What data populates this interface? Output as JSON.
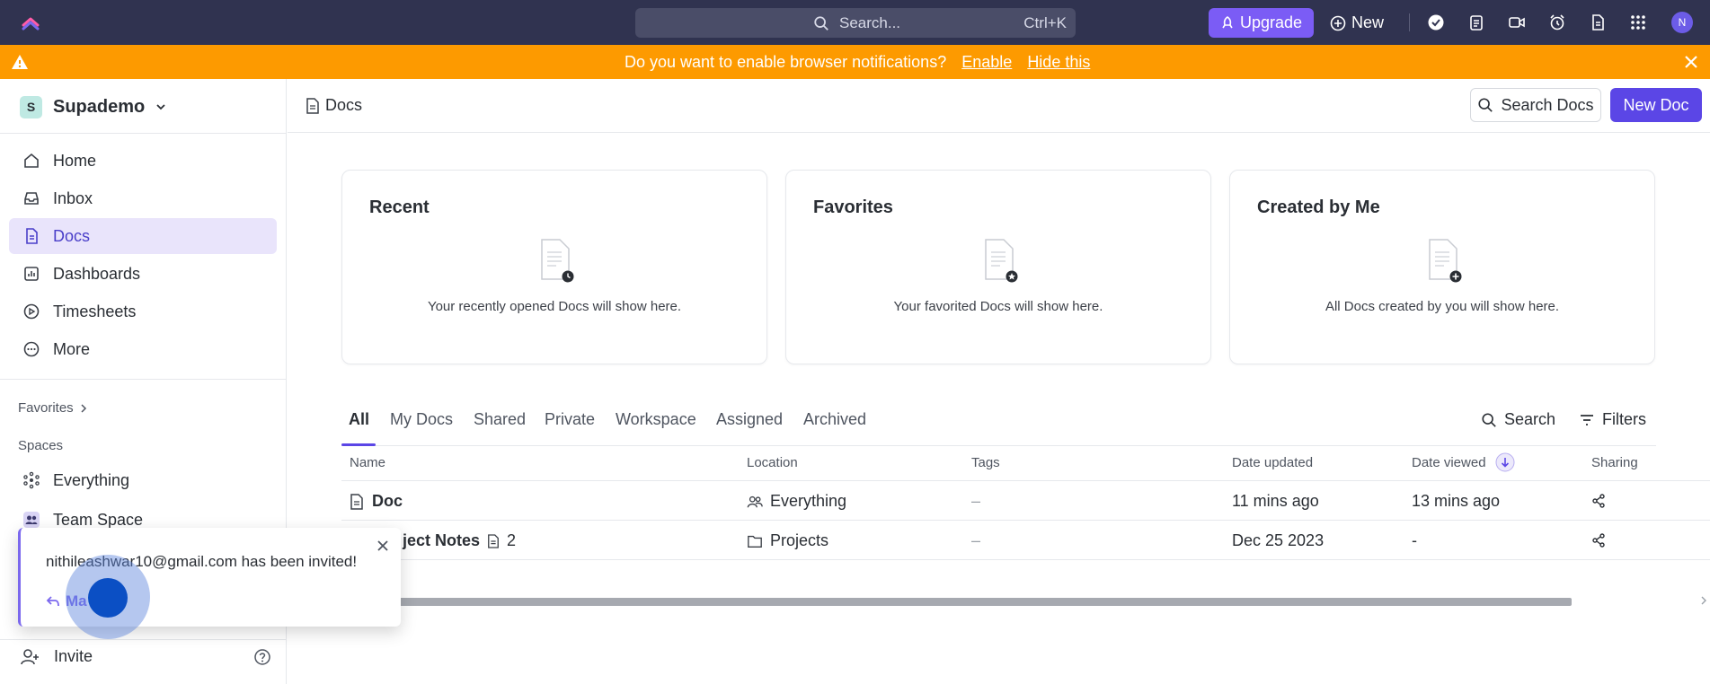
{
  "topbar": {
    "search_placeholder": "Search...",
    "search_shortcut": "Ctrl+K",
    "upgrade_label": "Upgrade",
    "new_label": "New",
    "avatar_initial": "N"
  },
  "banner": {
    "message": "Do you want to enable browser notifications?",
    "enable_label": "Enable",
    "hide_label": "Hide this"
  },
  "sidebar": {
    "workspace_initial": "S",
    "workspace_name": "Supademo",
    "items": [
      {
        "label": "Home",
        "icon": "home-icon"
      },
      {
        "label": "Inbox",
        "icon": "inbox-icon"
      },
      {
        "label": "Docs",
        "icon": "doc-icon",
        "active": true
      },
      {
        "label": "Dashboards",
        "icon": "dashboard-icon"
      },
      {
        "label": "Timesheets",
        "icon": "timesheet-icon"
      },
      {
        "label": "More",
        "icon": "more-icon"
      }
    ],
    "favorites_label": "Favorites",
    "spaces_label": "Spaces",
    "spaces": [
      {
        "label": "Everything",
        "icon": "everything-icon"
      },
      {
        "label": "Team Space",
        "icon": "team-icon"
      }
    ],
    "invite_label": "Invite"
  },
  "header": {
    "breadcrumb": "Docs",
    "search_docs_label": "Search Docs",
    "new_doc_label": "New Doc"
  },
  "cards": [
    {
      "title": "Recent",
      "text": "Your recently opened Docs will show here."
    },
    {
      "title": "Favorites",
      "text": "Your favorited Docs will show here."
    },
    {
      "title": "Created by Me",
      "text": "All Docs created by you will show here."
    }
  ],
  "tabs": {
    "items": [
      "All",
      "My Docs",
      "Shared",
      "Private",
      "Workspace",
      "Assigned",
      "Archived"
    ],
    "search_label": "Search",
    "filters_label": "Filters"
  },
  "table": {
    "columns": [
      "Name",
      "Location",
      "Tags",
      "Date updated",
      "Date viewed",
      "Sharing"
    ],
    "rows": [
      {
        "name": "Doc",
        "location": "Everything",
        "tags": "–",
        "updated": "11 mins ago",
        "viewed": "13 mins ago"
      },
      {
        "name": "ject Notes",
        "subcount": "2",
        "location": "Projects",
        "tags": "–",
        "updated": "Dec 25 2023",
        "viewed": "-"
      }
    ]
  },
  "toast": {
    "message": "nithileashwar10@gmail.com has been invited!",
    "action_label": "Ma"
  },
  "colors": {
    "topbar": "#303350",
    "banner": "#fd9a00",
    "accent": "#5b46e6",
    "upgrade": "#7b5cf5"
  }
}
